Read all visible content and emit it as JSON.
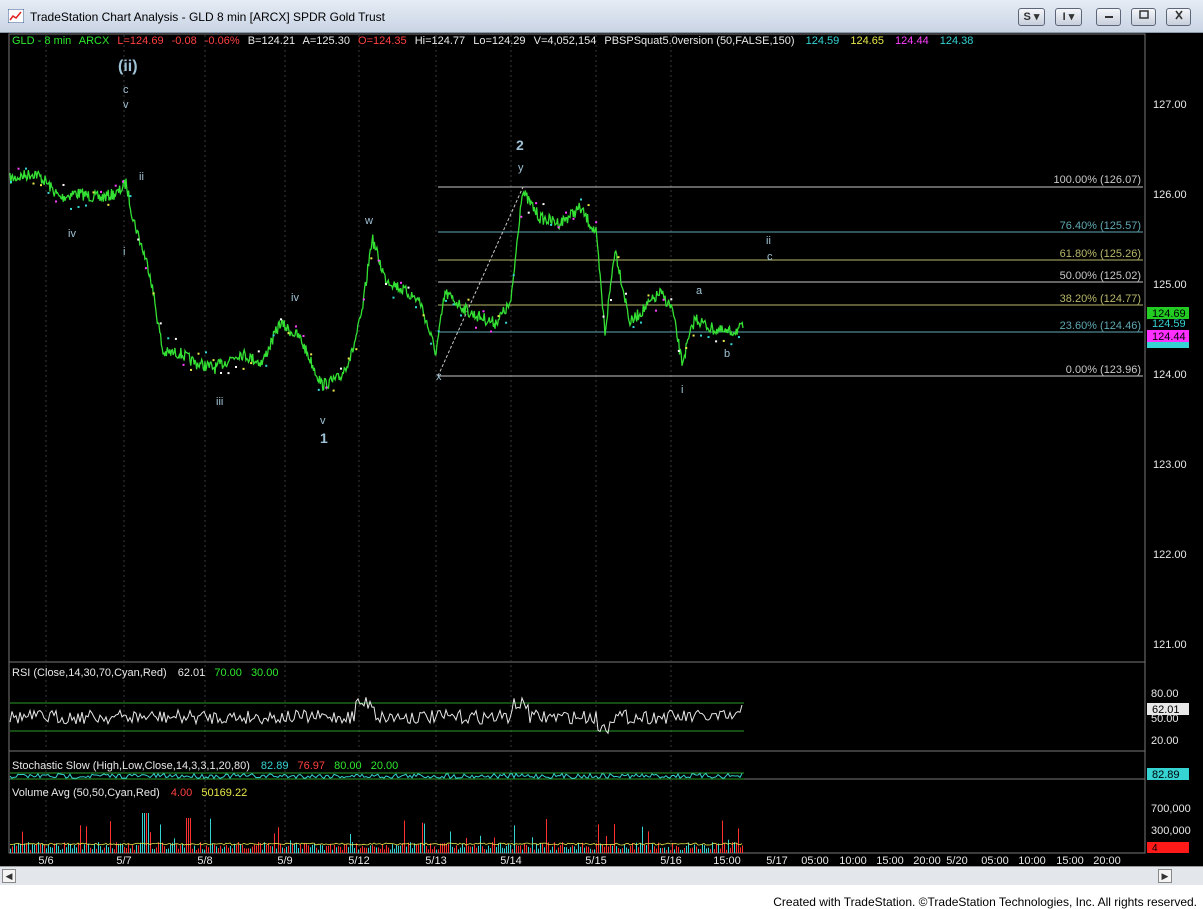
{
  "window": {
    "title": "TradeStation Chart Analysis - GLD 8 min [ARCX] SPDR Gold Trust",
    "btn_s": "S",
    "btn_i": "I"
  },
  "header": {
    "symbol": "GLD - 8 min",
    "exchange": "ARCX",
    "last": "L=124.69",
    "change": "-0.08",
    "pct": "-0.06%",
    "bid": "B=124.21",
    "ask": "A=125.30",
    "open": "O=124.35",
    "high": "Hi=124.77",
    "low": "Lo=124.29",
    "volume": "V=4,052,154",
    "study": "PBSPSquat5.0version (50,FALSE,150)",
    "study_v1": "124.59",
    "study_v2": "124.65",
    "study_v3": "124.44",
    "study_v4": "124.38"
  },
  "price_axis": [
    "127.00",
    "126.00",
    "125.00",
    "124.00",
    "123.00",
    "122.00",
    "121.00"
  ],
  "price_tags": {
    "t1": "124.69",
    "t2": "124.59",
    "t3": "124.44"
  },
  "fib_levels": [
    {
      "label": "100.00% (126.07)",
      "color": "#c8c8c8"
    },
    {
      "label": "76.40% (125.57)",
      "color": "#5fa9b3"
    },
    {
      "label": "61.80% (125.26)",
      "color": "#b8b86a"
    },
    {
      "label": "50.00% (125.02)",
      "color": "#c8c8c8"
    },
    {
      "label": "38.20% (124.77)",
      "color": "#b8b86a"
    },
    {
      "label": "23.60% (124.46)",
      "color": "#5fa9b3"
    },
    {
      "label": "0.00% (123.96)",
      "color": "#c8c8c8"
    }
  ],
  "wave_labels": {
    "ii_big": "(ii)",
    "c1": "c",
    "v1": "v",
    "ii_small": "ii",
    "iv1": "iv",
    "i1": "i",
    "iii1": "iii",
    "iv2": "iv",
    "v2": "v",
    "one": "1",
    "w": "w",
    "x": "x",
    "two": "2",
    "y": "y",
    "ii2": "ii",
    "c2": "c",
    "a": "a",
    "b": "b",
    "i2": "i"
  },
  "rsi": {
    "label": "RSI (Close,14,30,70,Cyan,Red)",
    "value": "62.01",
    "ob": "70.00",
    "os": "30.00",
    "axis": [
      "80.00",
      "50.00",
      "20.00"
    ],
    "tag": "62.01"
  },
  "stoch": {
    "label": "Stochastic Slow (High,Low,Close,14,3,3,1,20,80)",
    "k": "82.89",
    "d": "76.97",
    "l1": "80.00",
    "l2": "20.00",
    "tag": "82.89"
  },
  "volume": {
    "label": "Volume Avg (50,50,Cyan,Red)",
    "v1": "4.00",
    "v2": "50169.22",
    "axis": [
      "700,000",
      "300,000"
    ],
    "tag": "4"
  },
  "time_axis": [
    "5/6",
    "5/7",
    "5/8",
    "5/9",
    "5/12",
    "5/13",
    "5/14",
    "5/15",
    "5/16",
    "15:00",
    "5/17",
    "05:00",
    "10:00",
    "15:00",
    "20:00",
    "5/20",
    "05:00",
    "10:00",
    "15:00",
    "20:00"
  ],
  "footer": "Created with TradeStation. ©TradeStation Technologies, Inc. All rights reserved."
}
